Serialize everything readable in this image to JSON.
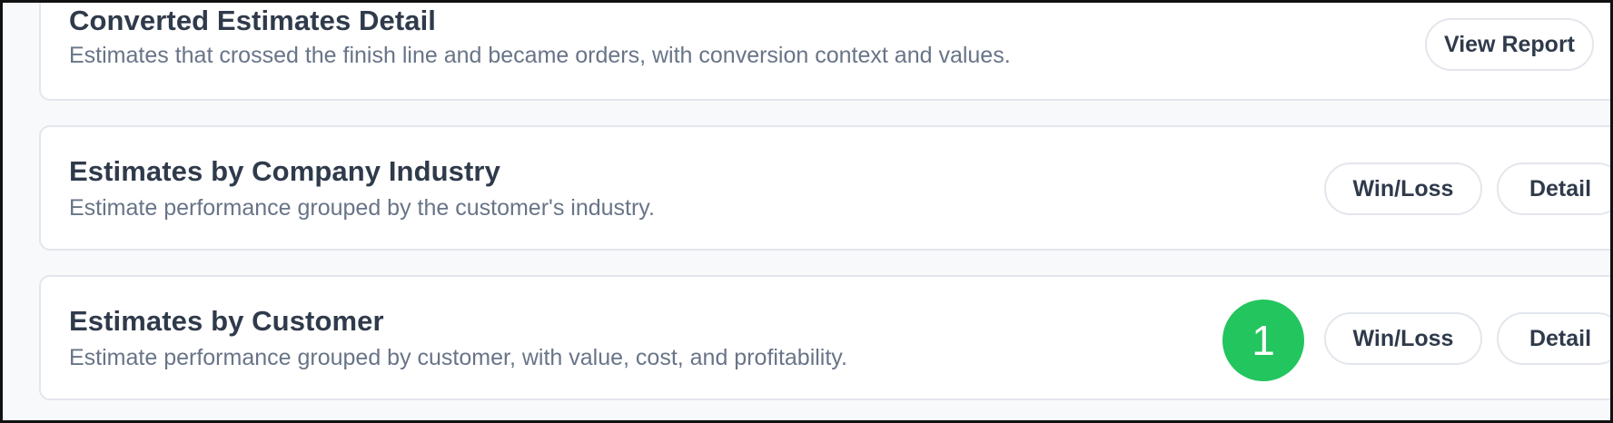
{
  "reports": [
    {
      "title": "Converted Estimates Detail",
      "description": "Estimates that crossed the finish line and became orders, with conversion context and values.",
      "buttons": [
        "View Report"
      ]
    },
    {
      "title": "Estimates by Company Industry",
      "description": "Estimate performance grouped by the customer's industry.",
      "buttons": [
        "Win/Loss",
        "Detail"
      ]
    },
    {
      "title": "Estimates by Customer",
      "description": "Estimate performance grouped by customer, with value, cost, and profitability.",
      "buttons": [
        "Win/Loss",
        "Detail"
      ]
    }
  ],
  "marker": {
    "label": "1",
    "color": "#22c55e"
  },
  "colors": {
    "title": "#2f3a4b",
    "description": "#687487",
    "border": "#e3e6ec"
  }
}
